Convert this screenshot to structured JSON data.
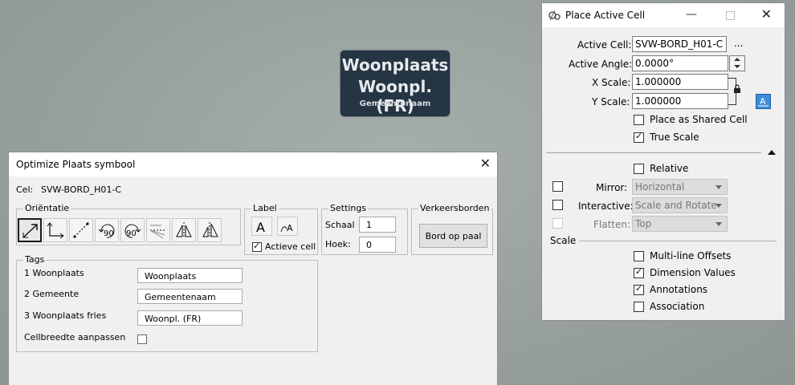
{
  "sign": {
    "line1": "Woonplaats",
    "line2": "Woonpl. (FR)",
    "line3": "Gemeentenaam",
    "bg": "#253543"
  },
  "optimize": {
    "title": "Optimize Plaats symbool",
    "cel_label": "Cel:",
    "cel_value": "SVW-BORD_H01-C",
    "orientatie_label": "Oriëntatie",
    "orientatie_icons": [
      "direction-arrow-icon",
      "axis-corner-icon",
      "dashed-line-icon",
      "rotate-90-ccw-icon",
      "rotate-90-cw-icon",
      "align-fan-icon",
      "mirror-vertical-icon",
      "mirror-triangle-icon"
    ],
    "rotate_left_text": "90",
    "rotate_right_text": "90",
    "label_group": "Label",
    "actieve_cell_label": "Actieve cell",
    "actieve_cell_checked": true,
    "settings_group": "Settings",
    "schaal_label": "Schaal",
    "schaal_value": "1",
    "hoek_label": "Hoek:",
    "hoek_value": "0",
    "verkeersborden_group": "Verkeersborden",
    "bord_button": "Bord op paal",
    "tags_group": "Tags",
    "tags": [
      {
        "label": "1 Woonplaats",
        "value": "Woonplaats"
      },
      {
        "label": "2 Gemeente",
        "value": "Gemeentenaam"
      },
      {
        "label": "3 Woonplaats fries",
        "value": "Woonpl. (FR)"
      }
    ],
    "cellbreedte_label": "Cellbreedte aanpassen"
  },
  "pac": {
    "title": "Place Active Cell",
    "active_cell_label": "Active Cell:",
    "active_cell_value": "SVW-BORD_H01-C",
    "browse_label": "...",
    "active_angle_label": "Active Angle:",
    "active_angle_value": "0.0000°",
    "x_scale_label": "X Scale:",
    "x_scale_value": "1.000000",
    "y_scale_label": "Y Scale:",
    "y_scale_value": "1.000000",
    "place_shared_label": "Place as Shared Cell",
    "true_scale_label": "True Scale",
    "relative_label": "Relative",
    "mirror_label": "Mirror:",
    "mirror_value": "Horizontal",
    "interactive_label": "Interactive:",
    "interactive_value": "Scale and Rotate",
    "flatten_label": "Flatten:",
    "flatten_value": "Top",
    "scale_section": "Scale",
    "multiline_label": "Multi-line Offsets",
    "dimension_label": "Dimension Values",
    "annotations_label": "Annotations",
    "association_label": "Association",
    "checks": {
      "place_shared": false,
      "true_scale": true,
      "relative": false,
      "multiline": false,
      "dimension": true,
      "annotations": true,
      "association": false
    }
  }
}
